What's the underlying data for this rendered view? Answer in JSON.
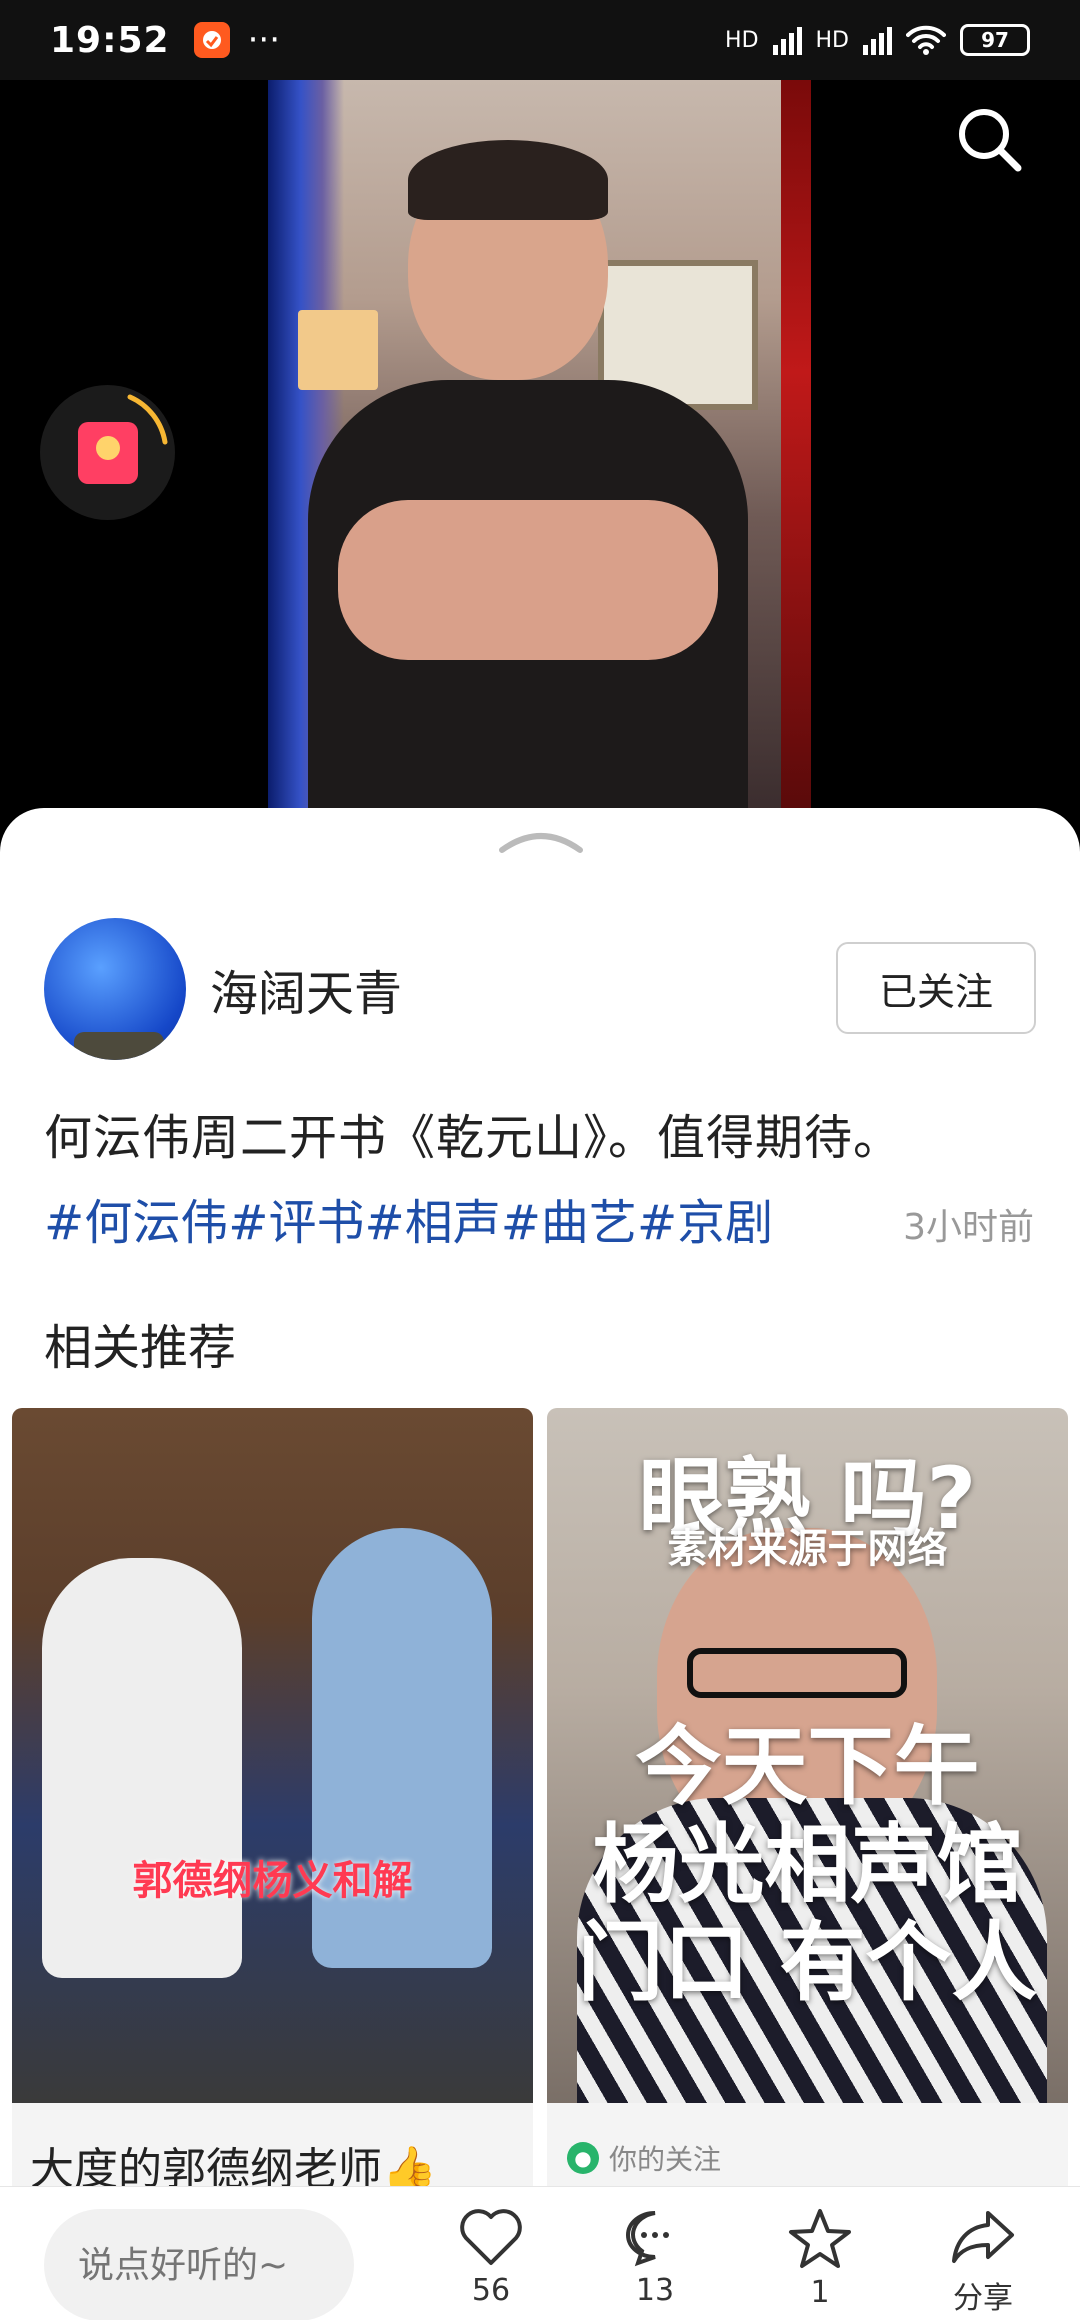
{
  "status_bar": {
    "time": "19:52",
    "more": "···",
    "battery": "97",
    "network": "HD"
  },
  "video": {
    "search_icon": "search-icon",
    "redpacket_icon": "red-envelope-icon"
  },
  "post": {
    "author": "海阔天青",
    "follow_label": "已关注",
    "text": "何沄伟周二开书《乾元山》。值得期待。",
    "tags": [
      "#何沄伟",
      "#评书",
      "#相声",
      "#曲艺",
      "#京剧"
    ],
    "time_ago": "3小时前"
  },
  "related": {
    "title": "相关推荐",
    "cards": [
      {
        "caption": "郭德纲杨义和解",
        "title": "大度的郭德纲老师👍"
      },
      {
        "overlay_line1": "眼熟 吗?",
        "overlay_line2": "素材来源于网络",
        "overlay_line3": "今天下午",
        "overlay_line4": "杨光相声馆",
        "overlay_line5": "门口 有个人",
        "meta": "你的关注"
      }
    ]
  },
  "bottom_bar": {
    "comment_placeholder": "说点好听的~",
    "like_count": "56",
    "comment_count": "13",
    "favorite_count": "1",
    "share_label": "分享"
  },
  "colors": {
    "accent_tag": "#1e4ea8",
    "redpacket": "#ff3f63"
  }
}
